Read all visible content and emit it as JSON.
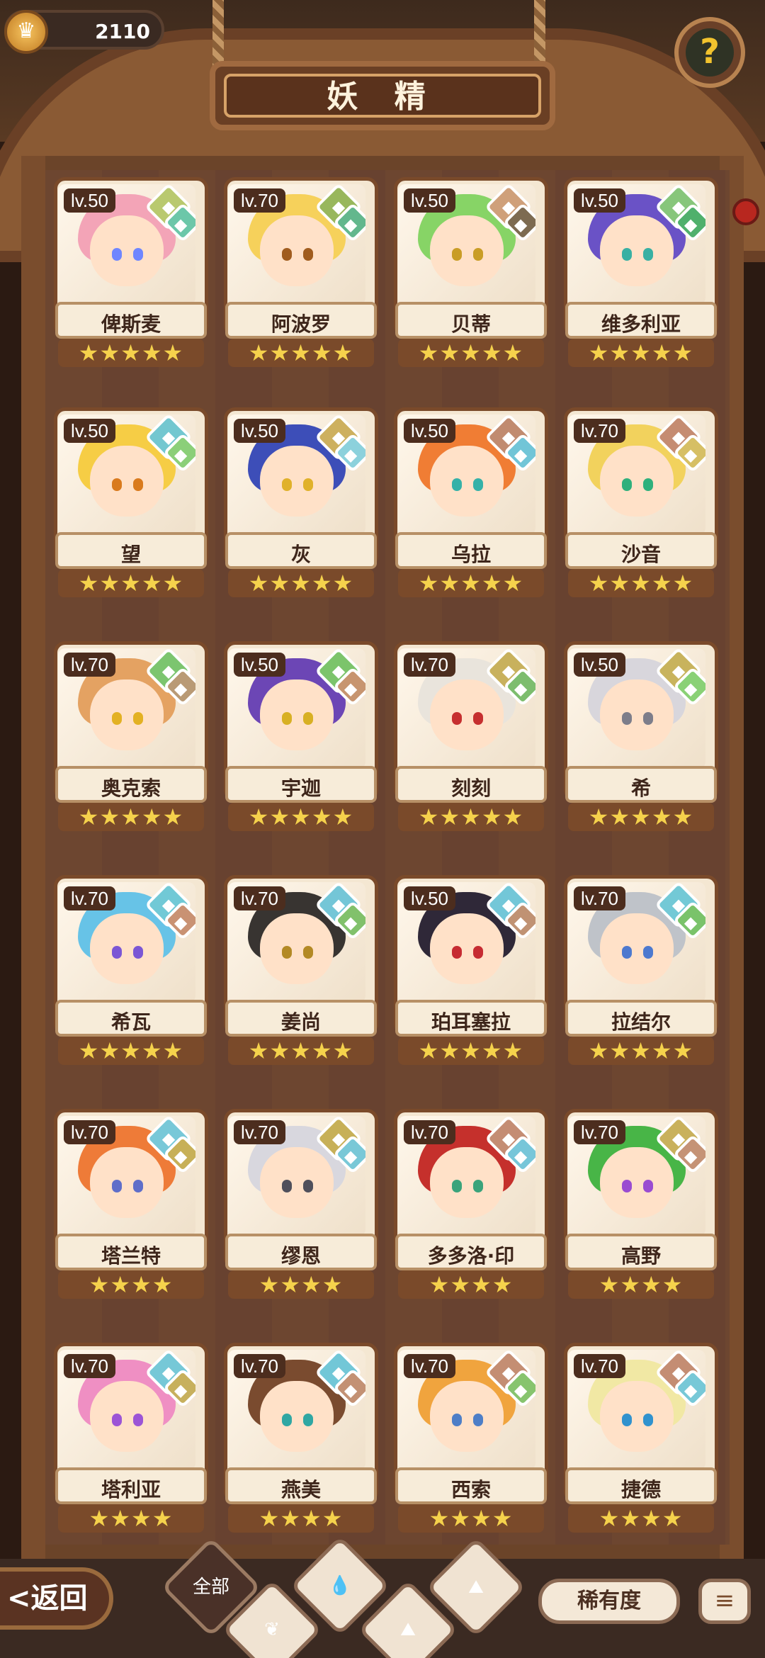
{
  "currency": {
    "value": "2110",
    "icon": "crown-coin-icon"
  },
  "title": "妖 精",
  "help_icon": "?",
  "cards": [
    {
      "name": "俾斯麦",
      "lv": "lv.50",
      "stars": "★★★★★",
      "hair": "#f3a4b7",
      "eye": "#6f86ff",
      "badges": [
        "#b9c96f",
        "#6cc7a9"
      ]
    },
    {
      "name": "阿波罗",
      "lv": "lv.70",
      "stars": "★★★★★",
      "hair": "#f6d15b",
      "eye": "#a05c1e",
      "badges": [
        "#98b75c",
        "#63b78d"
      ]
    },
    {
      "name": "贝蒂",
      "lv": "lv.50",
      "stars": "★★★★★",
      "hair": "#87d466",
      "eye": "#c99d26",
      "badges": [
        "#cfa07a",
        "#7d6b51"
      ]
    },
    {
      "name": "维多利亚",
      "lv": "lv.50",
      "stars": "★★★★★",
      "hair": "#6a52c6",
      "eye": "#38b0a3",
      "badges": [
        "#87c67b",
        "#50b06c"
      ]
    },
    {
      "name": "望",
      "lv": "lv.50",
      "stars": "★★★★★",
      "hair": "#f6cd45",
      "eye": "#d97a1d",
      "badges": [
        "#73c7d0",
        "#8bcf79"
      ]
    },
    {
      "name": "灰",
      "lv": "lv.50",
      "stars": "★★★★★",
      "hair": "#3d4eb8",
      "eye": "#e0b12a",
      "badges": [
        "#cdb05f",
        "#8cd1dc"
      ]
    },
    {
      "name": "乌拉",
      "lv": "lv.50",
      "stars": "★★★★★",
      "hair": "#f07d34",
      "eye": "#35b1a8",
      "badges": [
        "#c18b70",
        "#71c5d7"
      ]
    },
    {
      "name": "沙音",
      "lv": "lv.70",
      "stars": "★★★★★",
      "hair": "#f2d25d",
      "eye": "#2fb07c",
      "badges": [
        "#c58c72",
        "#d6bf65"
      ]
    },
    {
      "name": "奥克索",
      "lv": "lv.70",
      "stars": "★★★★★",
      "hair": "#e4a262",
      "eye": "#e3b123",
      "badges": [
        "#7cc56f",
        "#b99a75"
      ]
    },
    {
      "name": "宇迦",
      "lv": "lv.50",
      "stars": "★★★★★",
      "hair": "#6c46b5",
      "eye": "#d8b024",
      "badges": [
        "#7cc46b",
        "#c79570"
      ]
    },
    {
      "name": "刻刻",
      "lv": "lv.70",
      "stars": "★★★★★",
      "hair": "#e9e4dc",
      "eye": "#c62f2f",
      "badges": [
        "#c8b15d",
        "#7dbd6e"
      ]
    },
    {
      "name": "希",
      "lv": "lv.50",
      "stars": "★★★★★",
      "hair": "#d8d6dc",
      "eye": "#7d7d8a",
      "badges": [
        "#c8b35d",
        "#8ad176"
      ]
    },
    {
      "name": "希瓦",
      "lv": "lv.70",
      "stars": "★★★★★",
      "hair": "#67c3e7",
      "eye": "#7b56d5",
      "badges": [
        "#71c9d6",
        "#c99273"
      ]
    },
    {
      "name": "姜尚",
      "lv": "lv.70",
      "stars": "★★★★★",
      "hair": "#383431",
      "eye": "#b38925",
      "badges": [
        "#74c6d7",
        "#81c16b"
      ]
    },
    {
      "name": "珀耳塞拉",
      "lv": "lv.50",
      "stars": "★★★★★",
      "hair": "#2f2838",
      "eye": "#c62b32",
      "badges": [
        "#73c7d8",
        "#c09273"
      ]
    },
    {
      "name": "拉结尔",
      "lv": "lv.70",
      "stars": "★★★★★",
      "hair": "#bfc3c9",
      "eye": "#4d79cf",
      "badges": [
        "#73c9d6",
        "#7ac36a"
      ]
    },
    {
      "name": "塔兰特",
      "lv": "lv.70",
      "stars": "★★★★",
      "hair": "#ee7b38",
      "eye": "#5f6ec9",
      "badges": [
        "#78c8d8",
        "#c7b058"
      ]
    },
    {
      "name": "缪恩",
      "lv": "lv.70",
      "stars": "★★★★",
      "hair": "#d8d7de",
      "eye": "#4f4f5b",
      "badges": [
        "#c7b058",
        "#79c8d7"
      ]
    },
    {
      "name": "多多洛·印",
      "lv": "lv.70",
      "stars": "★★★★",
      "hair": "#c5302c",
      "eye": "#3aa37b",
      "badges": [
        "#c48d74",
        "#77c6d9"
      ]
    },
    {
      "name": "高野",
      "lv": "lv.70",
      "stars": "★★★★",
      "hair": "#48b547",
      "eye": "#9a4cd1",
      "badges": [
        "#c9b15c",
        "#c59376"
      ]
    },
    {
      "name": "塔利亚",
      "lv": "lv.70",
      "stars": "★★★★",
      "hair": "#ef8fc3",
      "eye": "#9c54d6",
      "badges": [
        "#76c8d7",
        "#c7b05d"
      ]
    },
    {
      "name": "燕美",
      "lv": "lv.70",
      "stars": "★★★★",
      "hair": "#7a4b2f",
      "eye": "#30a7a3",
      "badges": [
        "#72c7d7",
        "#c39174"
      ]
    },
    {
      "name": "西索",
      "lv": "lv.70",
      "stars": "★★★★",
      "hair": "#f0a43e",
      "eye": "#4e7ec7",
      "badges": [
        "#c48e73",
        "#87c46e"
      ]
    },
    {
      "name": "捷德",
      "lv": "lv.70",
      "stars": "★★★★",
      "hair": "#f1e8a4",
      "eye": "#3192ce",
      "badges": [
        "#c48d73",
        "#77c8d7"
      ]
    }
  ],
  "bottom": {
    "back": "<返回",
    "tabs": [
      {
        "label": "全部",
        "icon": "all"
      },
      {
        "label": "",
        "icon": "leaf-icon"
      },
      {
        "label": "",
        "icon": "water-icon"
      },
      {
        "label": "",
        "icon": "mountain-icon"
      },
      {
        "label": "",
        "icon": "mountain-icon"
      }
    ],
    "rarity": "稀有度",
    "sort": "≡"
  }
}
